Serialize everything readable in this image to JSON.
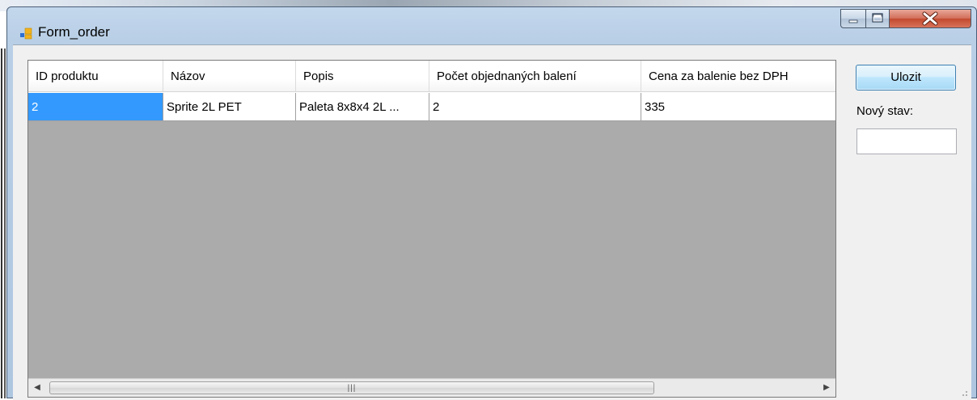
{
  "window": {
    "title": "Form_order",
    "controls": [
      "minimize",
      "maximize",
      "close"
    ]
  },
  "grid": {
    "columns": [
      "ID produktu",
      "Názov",
      "Popis",
      "Počet objednaných balení",
      "Cena za balenie bez DPH"
    ],
    "rows": [
      [
        "2",
        "Sprite 2L PET",
        "Paleta 8x8x4 2L ...",
        "2",
        "335"
      ]
    ],
    "selected_row": 0
  },
  "sidebar": {
    "save_label": "Ulozit",
    "new_state_label": "Nový stav:",
    "new_state_value": ""
  },
  "colors": {
    "selection": "#3399ff",
    "grid_background": "#ababab",
    "close_button": "#c24a2f"
  }
}
